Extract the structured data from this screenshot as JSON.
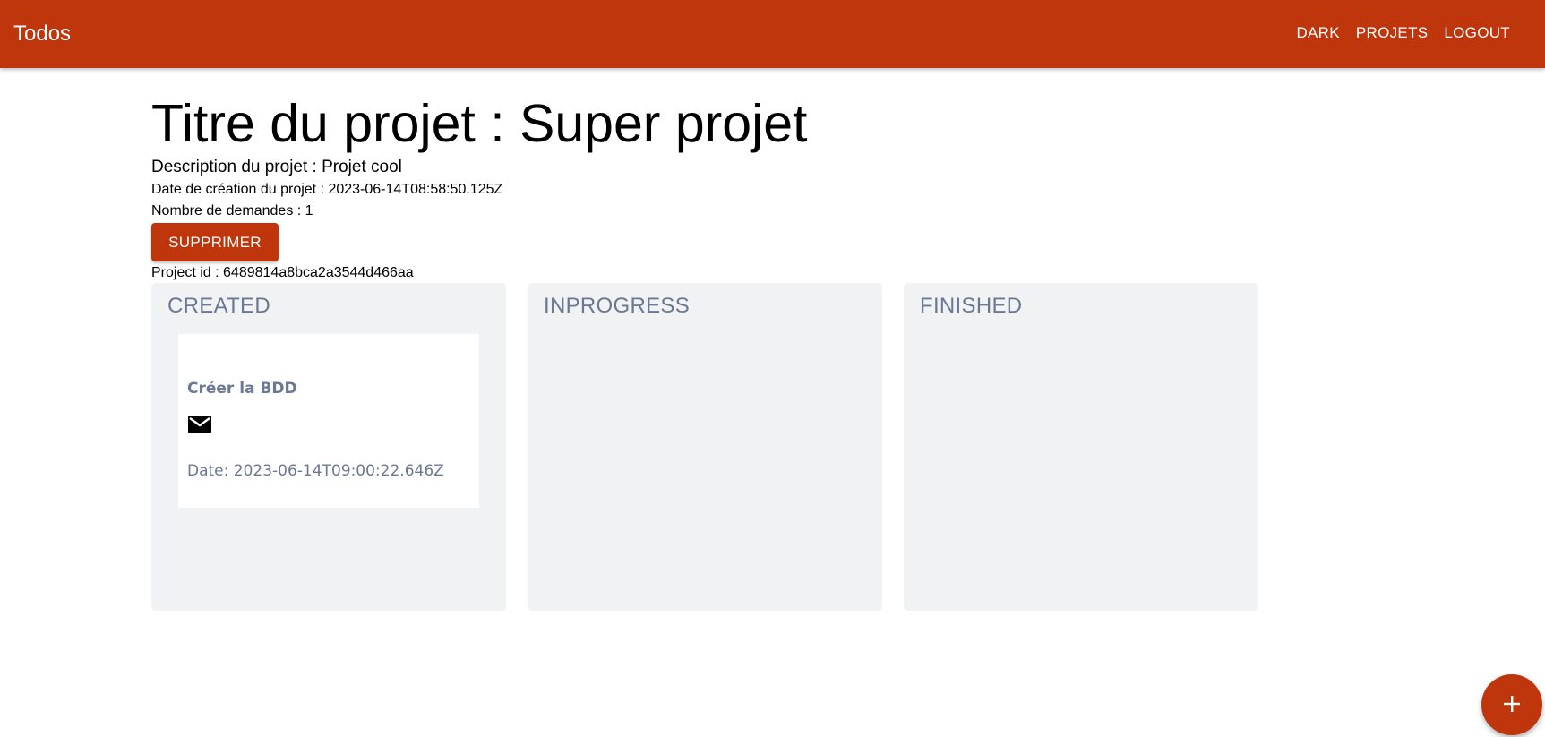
{
  "appbar": {
    "brand": "Todos",
    "nav": [
      "DARK",
      "PROJETS",
      "LOGOUT"
    ]
  },
  "project": {
    "title": "Titre du projet : Super projet",
    "description": "Description du projet : Projet cool",
    "created": "Date de création du projet : 2023-06-14T08:58:50.125Z",
    "count": "Nombre de demandes : 1",
    "delete_label": "SUPPRIMER",
    "id": "Project id : 6489814a8bca2a3544d466aa"
  },
  "columns": [
    {
      "title": "CREATED",
      "cards": [
        {
          "title": "Créer la BDD",
          "icon": "mail-icon",
          "date": "Date: 2023-06-14T09:00:22.646Z"
        }
      ]
    },
    {
      "title": "INPROGRESS",
      "cards": []
    },
    {
      "title": "FINISHED",
      "cards": []
    }
  ],
  "fab": {
    "icon": "plus-icon"
  },
  "colors": {
    "primary": "#bf360c",
    "column_bg": "#f1f2f4",
    "muted_text": "#6b7894"
  }
}
